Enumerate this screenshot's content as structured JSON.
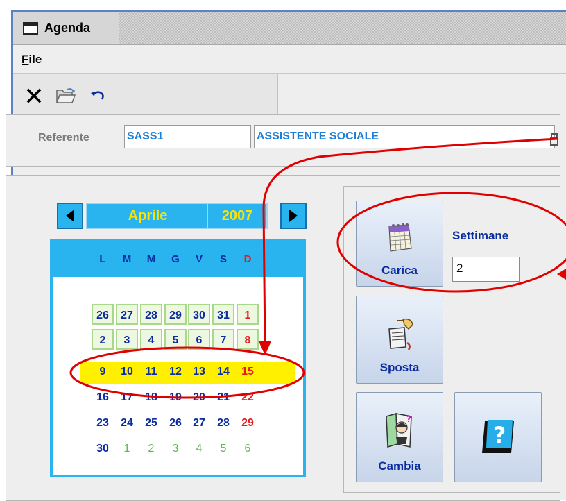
{
  "window": {
    "title": "Agenda"
  },
  "menu": {
    "file_mnemonic": "F",
    "file_rest": "ile"
  },
  "toolbar": {
    "icons": [
      "close-icon",
      "open-folder-icon",
      "undo-icon"
    ]
  },
  "referente": {
    "label": "Referente",
    "code": "SASS1",
    "description": "ASSISTENTE SOCIALE"
  },
  "calendar": {
    "month": "Aprile",
    "year": "2007",
    "weekdays": [
      "L",
      "M",
      "M",
      "G",
      "V",
      "S",
      "D"
    ],
    "weeks": [
      [
        "26",
        "27",
        "28",
        "29",
        "30",
        "31",
        "1"
      ],
      [
        "2",
        "3",
        "4",
        "5",
        "6",
        "7",
        "8"
      ],
      [
        "9",
        "10",
        "11",
        "12",
        "13",
        "14",
        "15"
      ],
      [
        "16",
        "17",
        "18",
        "19",
        "20",
        "21",
        "22"
      ],
      [
        "23",
        "24",
        "25",
        "26",
        "27",
        "28",
        "29"
      ],
      [
        "30",
        "1",
        "2",
        "3",
        "4",
        "5",
        "6"
      ]
    ],
    "selected_week_index": 2,
    "colors": {
      "accent": "#2ab4ef",
      "weekday": "#0b2c9f",
      "sunday": "#e81b1b",
      "highlight": "#fff000",
      "other_month": "#5ab84f"
    }
  },
  "actions": {
    "carica": "Carica",
    "sposta": "Sposta",
    "cambia": "Cambia",
    "help_glyph": "?"
  },
  "settimane": {
    "label": "Settimane",
    "value": "2"
  },
  "annotation_color": "#e00000"
}
